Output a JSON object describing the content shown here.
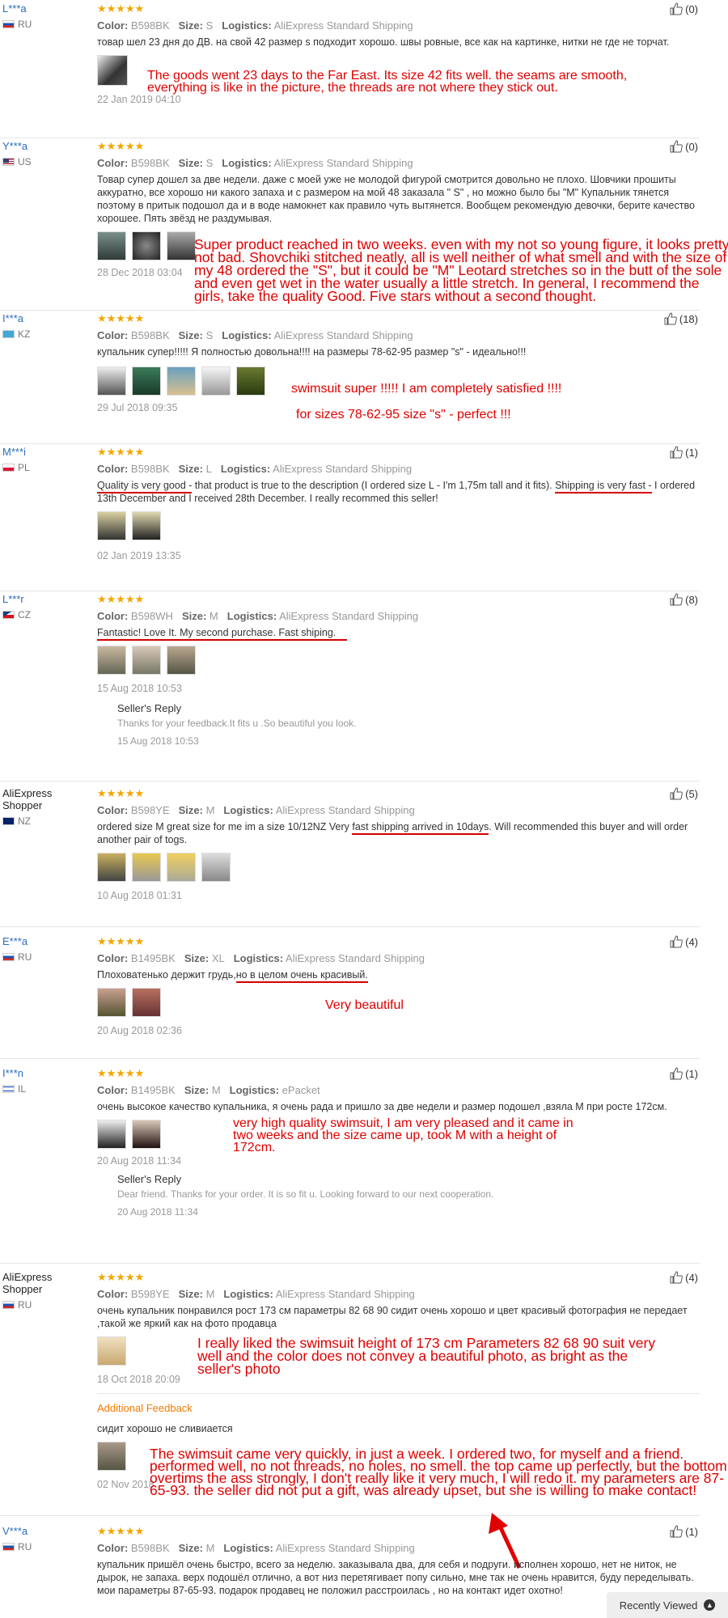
{
  "labels": {
    "color": "Color:",
    "size": "Size:",
    "logistics": "Logistics:",
    "sellers_reply": "Seller's Reply",
    "additional_feedback": "Additional Feedback"
  },
  "recently_viewed": "Recently Viewed",
  "reviews": [
    {
      "user": "L***a",
      "country": "RU",
      "stars": "★★★★★",
      "color": "B598BK",
      "size": "S",
      "logistics": "AliExpress Standard Shipping",
      "text": "товар шел 23 дня до ДВ. на свой 42 размер s подходит хорошо. швы ровные, все как на картинке, нитки не где не торчат.",
      "translation": "The goods went 23 days to the Far East. Its size 42 fits well. the seams are smooth, everything is like in the picture, the threads are not where they stick out.",
      "date": "22 Jan 2019 04:10",
      "helpful": "(0)"
    },
    {
      "user": "Y***a",
      "country": "US",
      "stars": "★★★★★",
      "color": "B598BK",
      "size": "S",
      "logistics": "AliExpress Standard Shipping",
      "text": "Товар супер дошел за две недели. даже с моей уже не молодой фигурой смотрится довольно не плохо. Шовчики прошиты аккуратно, все хорошо ни какого запаха и с размером на мой 48 заказала \" S\" , но можно было бы \"M\" Купальник тянется поэтому в притык подошол да и в воде намокнет как правило чуть вытянется. Вообщем рекомендую девочки, берите качество хорошее. Пять звёзд не раздумывая.",
      "translation": "Super product reached in two weeks. even with my not so young figure, it looks pretty not bad. Shovchiki stitched neatly, all is well neither of what smell and with the size of my 48 ordered the \"S\", but it could be \"M\" Leotard stretches so in the butt of the sole and even get wet in the water usually a little stretch. In general, I recommend the girls, take the quality Good. Five stars without a second thought.",
      "date": "28 Dec 2018 03:04",
      "helpful": "(0)"
    },
    {
      "user": "I***a",
      "country": "KZ",
      "stars": "★★★★★",
      "color": "B598BK",
      "size": "S",
      "logistics": "AliExpress Standard Shipping",
      "text": "купальник супер!!!!! Я полностью довольна!!!! на размеры 78-62-95 размер \"s\" - идеально!!!",
      "translation1": "swimsuit super !!!!! I am completely satisfied !!!!",
      "translation2": "for sizes 78-62-95 size \"s\" - perfect !!!",
      "date": "29 Jul 2018 09:35",
      "helpful": "(18)"
    },
    {
      "user": "M***i",
      "country": "PL",
      "stars": "★★★★★",
      "color": "B598BK",
      "size": "L",
      "logistics": "AliExpress Standard Shipping",
      "text_a": "Quality is very good -",
      "text_b": " that product is true to the description (I ordered size L - I'm 1,75m tall and it fits). ",
      "text_c": "Shipping is very fast -",
      "text_d": " I ordered 13th December and I received 28th December. I really recommed this seller!",
      "date": "02 Jan 2019 13:35",
      "helpful": "(1)"
    },
    {
      "user": "L***r",
      "country": "CZ",
      "stars": "★★★★★",
      "color": "B598WH",
      "size": "M",
      "logistics": "AliExpress Standard Shipping",
      "text": "Fantastic! Love It. My second purchase. Fast shiping.",
      "date": "15 Aug 2018 10:53",
      "helpful": "(8)",
      "reply": "Thanks for your feedback.It fits u .So beautiful you look.",
      "reply_date": "15 Aug 2018 10:53"
    },
    {
      "user": "AliExpress Shopper",
      "country": "NZ",
      "stars": "★★★★★",
      "color": "B598YE",
      "size": "M",
      "logistics": "AliExpress Standard Shipping",
      "text_a": "ordered size M great size for me im a size 10/12NZ Very ",
      "text_b": "fast shipping arrived in 10days",
      "text_c": ". Will recommended this buyer and will order another pair of togs.",
      "date": "10 Aug 2018 01:31",
      "helpful": "(5)"
    },
    {
      "user": "E***a",
      "country": "RU",
      "stars": "★★★★★",
      "color": "B1495BK",
      "size": "XL",
      "logistics": "AliExpress Standard Shipping",
      "text_a": "Плоховатенько держит грудь,",
      "text_b": "но в целом очень красивый.",
      "translation": "Very beautiful",
      "date": "20 Aug 2018 02:36",
      "helpful": "(4)"
    },
    {
      "user": "I***n",
      "country": "IL",
      "stars": "★★★★★",
      "color": "B1495BK",
      "size": "M",
      "logistics": "ePacket",
      "text": "очень высокое качество купальника, я очень рада и пришло за две недели и размер подошел ,взяла M при росте 172см.",
      "translation": "very high quality swimsuit, I am very pleased and it came in two weeks and the size came up, took M with a height of 172cm.",
      "date": "20 Aug 2018 11:34",
      "helpful": "(1)",
      "reply": "Dear friend. Thanks for your order. It is so fit u. Looking forward to our next cooperation.",
      "reply_date": "20 Aug 2018 11:34"
    },
    {
      "user": "AliExpress Shopper",
      "country": "RU",
      "stars": "★★★★★",
      "color": "B598YE",
      "size": "M",
      "logistics": "AliExpress Standard Shipping",
      "text": "очень купальник понравился рост 173 см параметры 82 68 90 сидит очень хорошо и цвет красивый фотография не передает ,такой же яркий как на фото продавца",
      "translation": "I really liked the swimsuit height of 173 cm Parameters 82 68 90 suit very well and the color does not convey a beautiful photo, as bright as the seller's photo",
      "date": "18 Oct 2018 20:09",
      "helpful": "(4)",
      "additional_text": "сидит хорошо не сливиается",
      "additional_date": "02 Nov 2018",
      "translation2": "The swimsuit came very quickly, in just a week. I ordered two, for myself and a friend. performed well, no not threads, no holes, no smell. the top came up perfectly, but the bottom overtims the ass strongly, I don't really like it very much, I will redo it. my parameters are 87-65-93. the seller did not put a gift, was already upset, but she is willing to make contact!"
    },
    {
      "user": "V***a",
      "country": "RU",
      "stars": "★★★★★",
      "color": "B598BK",
      "size": "M",
      "logistics": "AliExpress Standard Shipping",
      "text": "купальник пришёл очень быстро, всего за неделю. заказывала два, для себя и подруги. исполнен хорошо, нет не ниток, не дырок, не запаха. верх подошёл отлично, а вот низ перетягивает попу сильно, мне так не очень нравится, буду переделывать. мои параметры 87-65-93. подарок продавец не положил расстроилась , но на контакт идет охотно!",
      "helpful": "(1)"
    }
  ]
}
